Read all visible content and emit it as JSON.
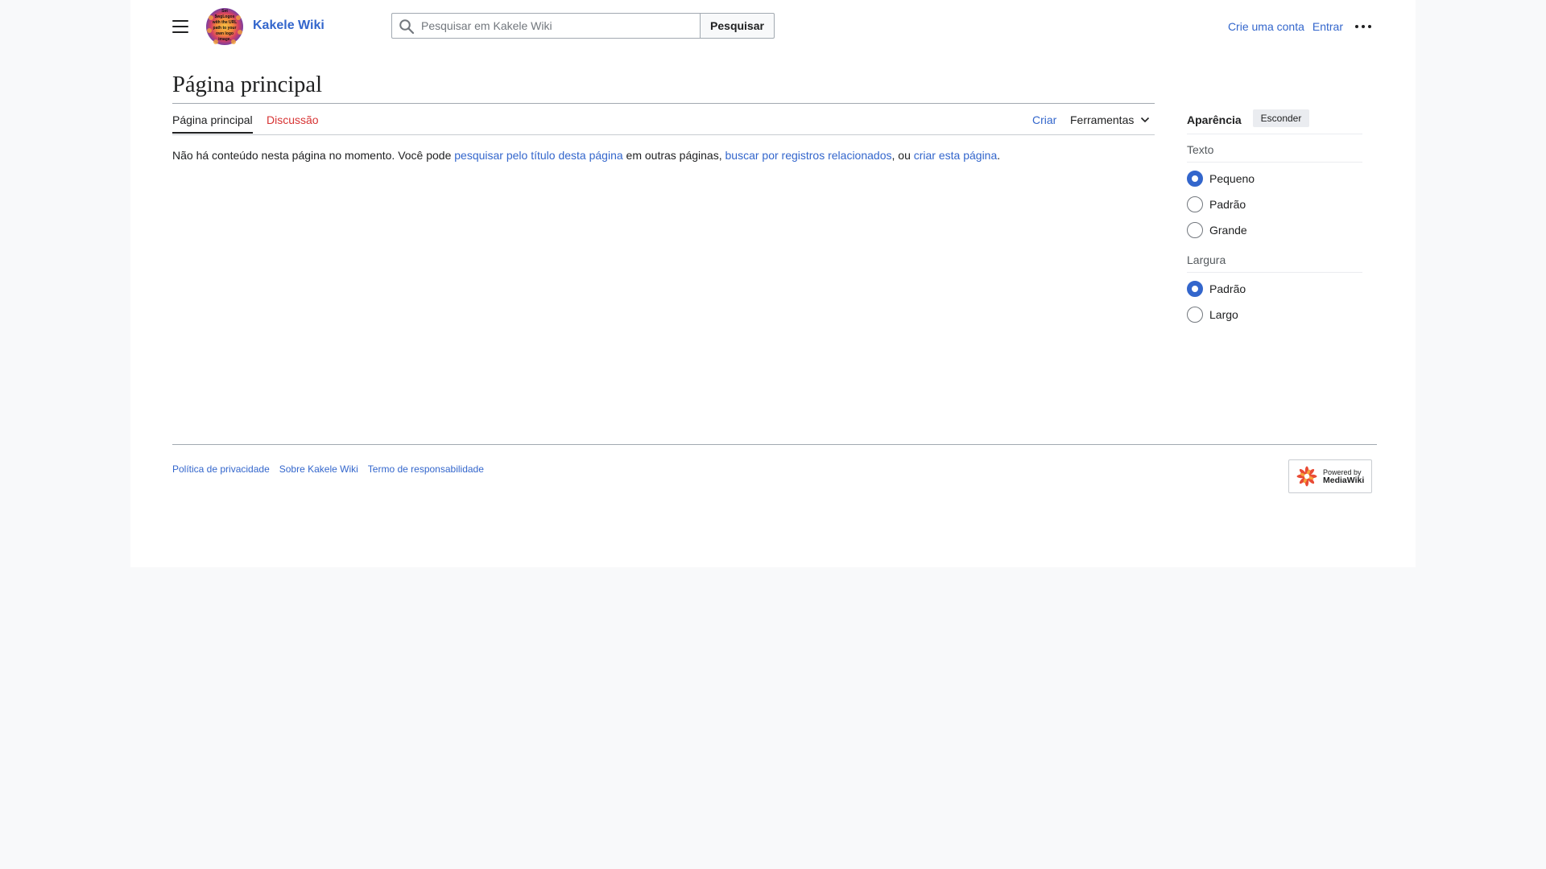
{
  "header": {
    "site_name": "Kakele Wiki",
    "logo_text": [
      "Set",
      "$wgLogos",
      "with the URL",
      "path to your",
      "own logo",
      "image."
    ],
    "search": {
      "placeholder": "Pesquisar em Kakele Wiki",
      "button_label": "Pesquisar"
    },
    "user_links": {
      "create_account": "Crie uma conta",
      "login": "Entrar"
    }
  },
  "page": {
    "title": "Página principal",
    "tabs": {
      "main": "Página principal",
      "talk": "Discussão",
      "create": "Criar",
      "tools": "Ferramentas"
    },
    "body": {
      "part1": "Não há conteúdo nesta página no momento. Você pode ",
      "link1": "pesquisar pelo título desta página",
      "part2": " em outras páginas, ",
      "link2": "buscar por registros relacionados",
      "part3": ", ou ",
      "link3": "criar esta página",
      "part4": "."
    }
  },
  "appearance": {
    "title": "Aparência",
    "hide_label": "Esconder",
    "text_section": {
      "label": "Texto",
      "options": [
        "Pequeno",
        "Padrão",
        "Grande"
      ],
      "selected": "Pequeno"
    },
    "width_section": {
      "label": "Largura",
      "options": [
        "Padrão",
        "Largo"
      ],
      "selected": "Padrão"
    }
  },
  "footer": {
    "links": [
      "Política de privacidade",
      "Sobre Kakele Wiki",
      "Termo de responsabilidade"
    ],
    "powered_by": {
      "line1": "Powered by",
      "line2": "MediaWiki"
    }
  },
  "colors": {
    "link": "#3366cc",
    "redlink": "#d73333",
    "text": "#202122",
    "page_bg": "#f8f9fa"
  }
}
